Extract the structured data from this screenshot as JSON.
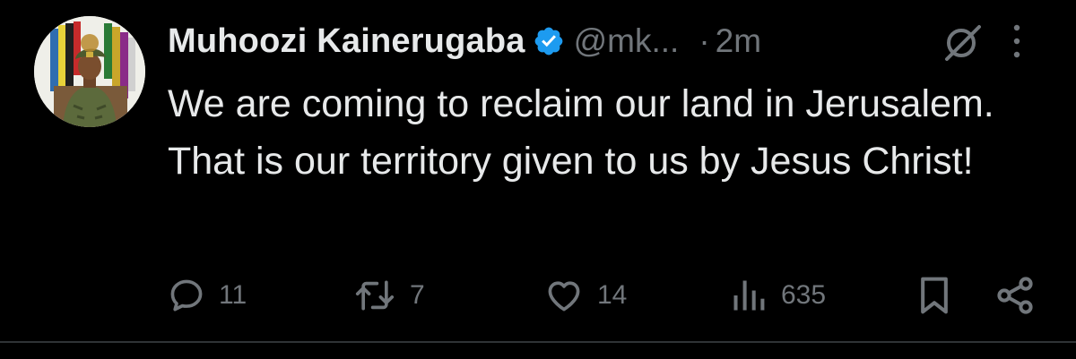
{
  "tweet": {
    "author_name": "Muhoozi Kainerugaba",
    "handle": "@mk...",
    "separator": "·",
    "time": "2m",
    "text": "We are coming to reclaim our land in Jerusalem. That is our territory given to us by Jesus Christ!",
    "verified": true
  },
  "actions": {
    "reply_count": "11",
    "repost_count": "7",
    "like_count": "14",
    "views_count": "635"
  },
  "icons": {
    "verified": "verified-badge-icon",
    "grok": "grok-icon",
    "more": "more-options-icon",
    "reply": "reply-icon",
    "repost": "repost-icon",
    "like": "heart-icon",
    "views": "views-icon",
    "bookmark": "bookmark-icon",
    "share": "share-icon"
  },
  "colors": {
    "background": "#000000",
    "primary_text": "#e7e9ea",
    "secondary_text": "#71767b",
    "verified_blue": "#1d9bf0"
  }
}
